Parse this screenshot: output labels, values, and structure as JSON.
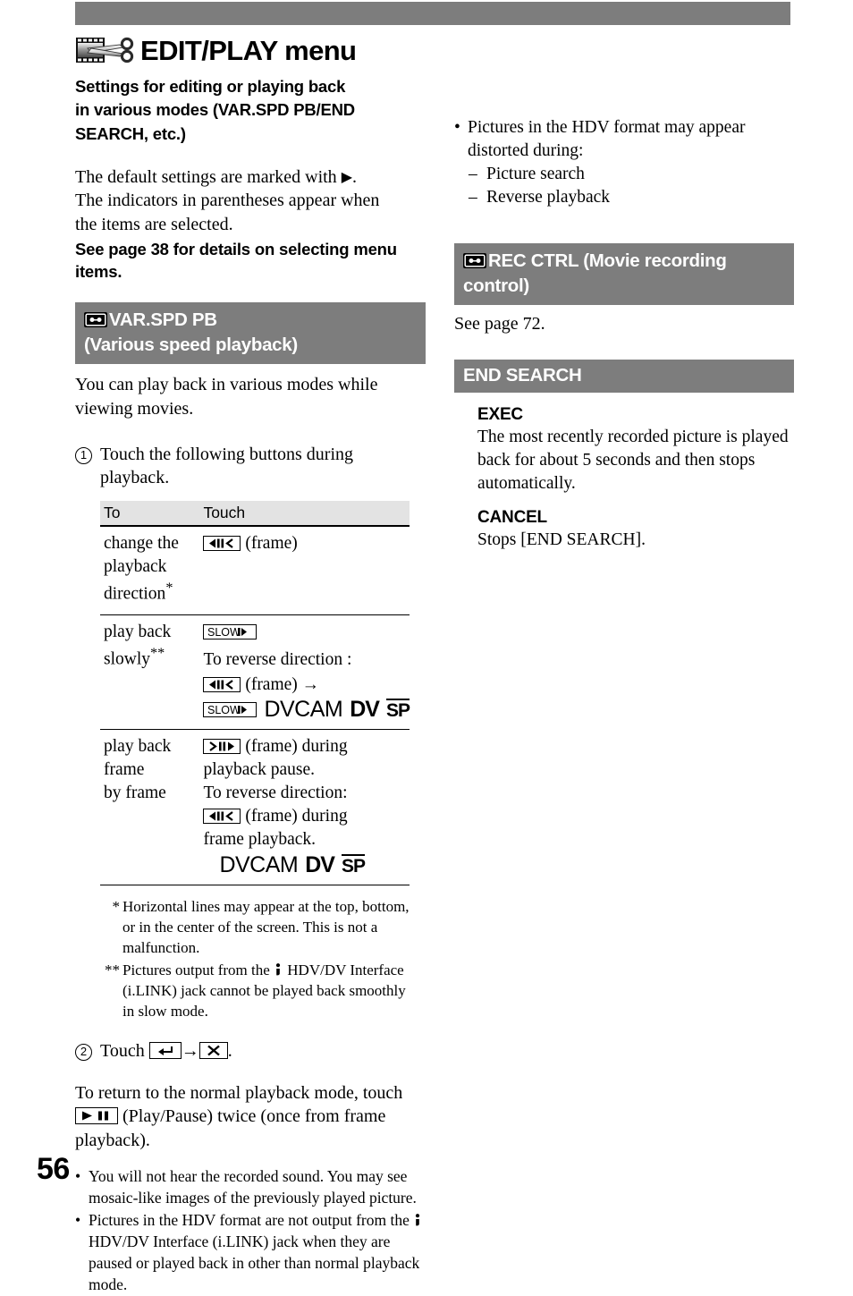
{
  "page": {
    "number": "56",
    "top_band_color": "#7d7d7d",
    "header_bar_color": "#7d7d7d",
    "table_header_color": "#e3e3e3"
  },
  "chapter": {
    "title": "EDIT/PLAY menu",
    "icon": "film-scissors-icon",
    "lead_lines": [
      "Settings for editing or playing back",
      "in various modes (VAR.SPD PB/END",
      "SEARCH, etc.)"
    ]
  },
  "intro": {
    "paragraph": "The default settings are marked with ▶.\nThe indicators in parentheses appear when\nthe items are selected.",
    "line1a": "The default settings are marked with ",
    "line1b": ".",
    "line2": "The indicators in parentheses appear when",
    "line3": "the items are selected.",
    "bold_note": "See page 38 for details on selecting menu items."
  },
  "sections": {
    "var_spd_pb": {
      "icon": "cassette-icon",
      "title_line1": "VAR.SPD PB",
      "title_line2": "(Various speed playback)",
      "intro": "You can play back in various modes while viewing movies.",
      "step1": {
        "number": "1",
        "text": "Touch the following buttons during playback."
      },
      "table": {
        "headers": [
          "To",
          "Touch"
        ],
        "rows": [
          {
            "to": "change the playback direction*",
            "touch_lines": [
              {
                "type": "button-text",
                "button": "frame-reverse-button",
                "text": "(frame)"
              }
            ],
            "formats": []
          },
          {
            "to": "play back slowly**",
            "touch_lines": [
              {
                "type": "button",
                "button": "slow-button"
              },
              {
                "type": "text",
                "text": "To reverse direction :"
              },
              {
                "type": "button-text",
                "button": "frame-reverse-button",
                "text": "(frame) →"
              },
              {
                "type": "button-formats",
                "button": "slow-button"
              }
            ],
            "formats": [
              "DVCAM",
              "DV",
              "SP"
            ]
          },
          {
            "to": "play back frame by frame",
            "touch_lines": [
              {
                "type": "button-text",
                "button": "frame-forward-button",
                "text": "(frame) during"
              },
              {
                "type": "text",
                "text": "playback pause."
              },
              {
                "type": "text",
                "text": "To reverse direction:"
              },
              {
                "type": "button-text",
                "button": "frame-reverse-button",
                "text": "(frame) during"
              },
              {
                "type": "text",
                "text": "frame playback."
              },
              {
                "type": "formats"
              }
            ],
            "formats": [
              "DVCAM",
              "DV",
              "SP"
            ]
          }
        ]
      },
      "footnotes": [
        {
          "mark": "*",
          "text": "Horizontal lines may appear at the top, bottom, or in the center of the screen. This is not a malfunction."
        },
        {
          "mark": "**",
          "text_before": "Pictures output from the ",
          "icon": "ilink-icon",
          "text_after": " HDV/DV Interface (i.LINK) jack cannot be played back smoothly in slow mode."
        }
      ],
      "step2": {
        "number": "2",
        "text_before": "Touch ",
        "button_return": "return-button",
        "arrow": "→",
        "button_close": "close-button",
        "text_after": "."
      },
      "return_note_before": "To return to the normal playback mode, touch ",
      "return_note_button": "play-pause-button",
      "return_note_after": " (Play/Pause) twice (once from frame playback).",
      "notes": [
        {
          "text": "You will not hear the recorded sound. You may see mosaic-like images of the previously played picture."
        },
        {
          "text_before": "Pictures in the HDV format are not output from the ",
          "icon": "ilink-icon",
          "text_after": " HDV/DV Interface (i.LINK) jack when they are paused or played back in other than normal playback mode."
        }
      ]
    },
    "right_notes": [
      {
        "text": "Pictures in the HDV format may appear distorted during:",
        "sub": [
          "Picture search",
          "Reverse playback"
        ]
      }
    ],
    "rec_ctrl": {
      "icon": "cassette-icon",
      "title_line1": "REC CTRL (Movie recording",
      "title_line2": "control)",
      "body": "See page 72."
    },
    "end_search": {
      "title": "END SEARCH",
      "items": [
        {
          "name": "EXEC",
          "body": "The most recently recorded picture is played back for about 5 seconds and then stops automatically."
        },
        {
          "name": "CANCEL",
          "body": "Stops [END SEARCH]."
        }
      ]
    }
  },
  "icons": {
    "frame_reverse_label": "frame-reverse",
    "frame_forward_label": "frame-forward",
    "slow_label": "SLOW",
    "close_label": "X"
  }
}
